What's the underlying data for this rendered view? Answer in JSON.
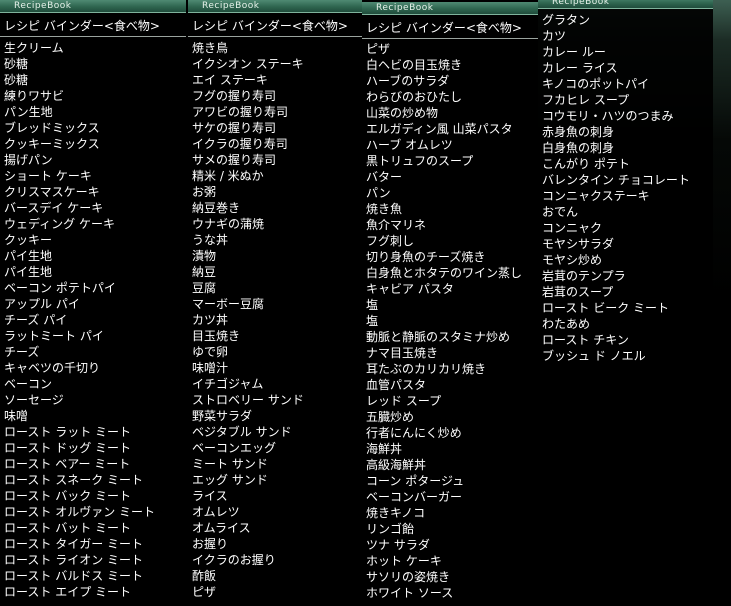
{
  "window_title": "RecipeBook",
  "header": "レシピ バインダー<食べ物>",
  "columns": [
    {
      "title": "RecipeBook",
      "header": "レシピ バインダー<食べ物>",
      "items": [
        "生クリーム",
        "砂糖",
        "砂糖",
        "練りワサビ",
        "パン生地",
        "ブレッドミックス",
        "クッキーミックス",
        "揚げパン",
        "ショート ケーキ",
        "クリスマスケーキ",
        "バースデイ ケーキ",
        "ウェディング ケーキ",
        "クッキー",
        "パイ生地",
        "パイ生地",
        "ベーコン ポテトパイ",
        "アップル パイ",
        "チーズ パイ",
        "ラットミート パイ",
        "チーズ",
        "キャベツの千切り",
        "ベーコン",
        "ソーセージ",
        "味噌",
        "ロースト ラット ミート",
        "ロースト ドッグ ミート",
        "ロースト ベアー ミート",
        "ロースト スネーク ミート",
        "ロースト バック ミート",
        "ロースト オルヴァン ミート",
        "ロースト バット ミート",
        "ロースト タイガー ミート",
        "ロースト ライオン ミート",
        "ロースト バルドス ミート",
        "ロースト エイプ ミート"
      ]
    },
    {
      "title": "RecipeBook",
      "header": "レシピ バインダー<食べ物>",
      "items": [
        "焼き鳥",
        "イクシオン ステーキ",
        "エイ ステーキ",
        "フグの握り寿司",
        "アワビの握り寿司",
        "サケの握り寿司",
        "イクラの握り寿司",
        "サメの握り寿司",
        "精米 / 米ぬか",
        "お粥",
        "納豆巻き",
        "ウナギの蒲焼",
        "うな丼",
        "漬物",
        "納豆",
        "豆腐",
        "マーボー豆腐",
        "カツ丼",
        "目玉焼き",
        "ゆで卵",
        "味噌汁",
        "イチゴジャム",
        "ストロベリー サンド",
        "野菜サラダ",
        "ベジタブル サンド",
        "ベーコンエッグ",
        "ミート サンド",
        "エッグ サンド",
        "ライス",
        "オムレツ",
        "オムライス",
        "お握り",
        "イクラのお握り",
        "酢飯",
        "ピザ"
      ]
    },
    {
      "title": "RecipeBook",
      "header": "レシピ バインダー<食べ物>",
      "items": [
        "ピザ",
        "白ヘビの目玉焼き",
        "ハーブのサラダ",
        "わらびのおひたし",
        "山菜の炒め物",
        "エルガディン風 山菜パスタ",
        "ハーブ オムレツ",
        "黒トリュフのスープ",
        "バター",
        "パン",
        "焼き魚",
        "魚介マリネ",
        "フグ刺し",
        "切り身魚のチーズ焼き",
        "白身魚とホタテのワイン蒸し",
        "キャビア パスタ",
        "塩",
        "塩",
        "動脈と静脈のスタミナ炒め",
        "ナマ目玉焼き",
        "耳たぶのカリカリ焼き",
        "血管パスタ",
        "レッド スープ",
        "五臓炒め",
        "行者にんにく炒め",
        "海鮮丼",
        "高級海鮮丼",
        "コーン ポタージュ",
        "ベーコンバーガー",
        "焼きキノコ",
        "リンゴ飴",
        "ツナ サラダ",
        "ホット ケーキ",
        "サソリの姿焼き",
        "ホワイト ソース"
      ]
    },
    {
      "title": "RecipeBook",
      "items": [
        "グラタン",
        "カツ",
        "カレー ルー",
        "カレー ライス",
        "キノコのポットパイ",
        "フカヒレ スープ",
        "コウモリ・ハツのつまみ",
        "赤身魚の刺身",
        "白身魚の刺身",
        "こんがり ポテト",
        "バレンタイン チョコレート",
        "コンニャクステーキ",
        "おでん",
        "コンニャク",
        "モヤシサラダ",
        "モヤシ炒め",
        "岩茸のテンプラ",
        "岩茸のスープ",
        "ロースト ビーク ミート",
        "わたあめ",
        "ロースト チキン",
        "ブッシュ ド ノエル"
      ]
    }
  ]
}
